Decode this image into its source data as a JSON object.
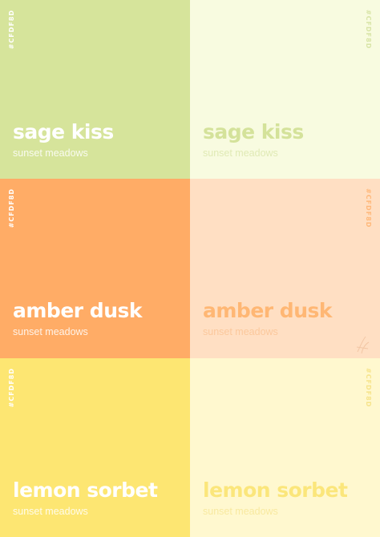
{
  "swatches": [
    {
      "name": "sage kiss",
      "subtitle": "sunset meadows",
      "hex_label": "#CFDF8D",
      "dark_bg": "#d6e49b",
      "light_bg": "#f8fbe0",
      "light_title": "#d4e29a",
      "light_sub": "#e0eab5",
      "light_hex": "#d8e4a6"
    },
    {
      "name": "amber dusk",
      "subtitle": "sunset meadows",
      "hex_label": "#CFDF8D",
      "dark_bg": "#ffac66",
      "light_bg": "#ffdfc3",
      "light_title": "#ffb774",
      "light_sub": "#fbc89c",
      "light_hex": "#ffb87a"
    },
    {
      "name": "lemon sorbet",
      "subtitle": "sunset meadows",
      "hex_label": "#CFDF8D",
      "dark_bg": "#fde672",
      "light_bg": "#fff8cf",
      "light_title": "#fbe67b",
      "light_sub": "#f8e9a0",
      "light_hex": "#f6e38a"
    }
  ]
}
